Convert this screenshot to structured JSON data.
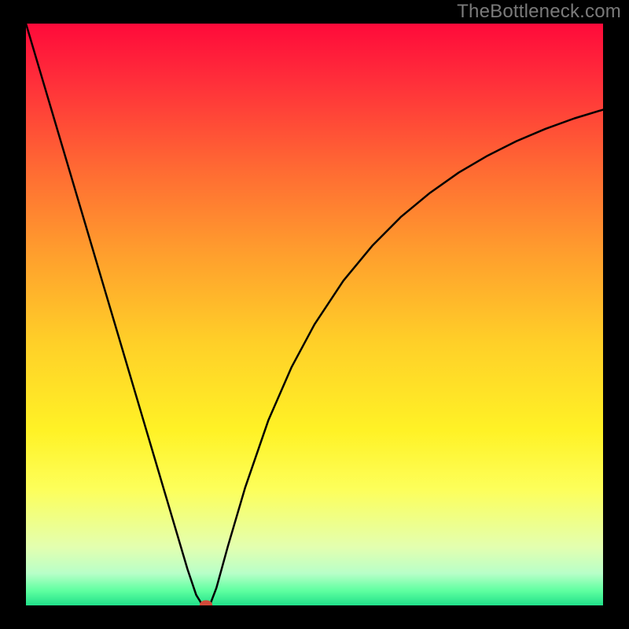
{
  "watermark": "TheBottleneck.com",
  "chart_data": {
    "type": "line",
    "title": "",
    "xlabel": "",
    "ylabel": "",
    "xlim": [
      0,
      100
    ],
    "ylim": [
      0,
      100
    ],
    "background_gradient": {
      "stops": [
        {
          "offset": 0.0,
          "color": "#ff0a3a"
        },
        {
          "offset": 0.1,
          "color": "#ff2f3a"
        },
        {
          "offset": 0.25,
          "color": "#ff6a33"
        },
        {
          "offset": 0.4,
          "color": "#ffa02d"
        },
        {
          "offset": 0.55,
          "color": "#ffd028"
        },
        {
          "offset": 0.7,
          "color": "#fff226"
        },
        {
          "offset": 0.8,
          "color": "#fdff5a"
        },
        {
          "offset": 0.9,
          "color": "#e3ffb0"
        },
        {
          "offset": 0.945,
          "color": "#b8ffc8"
        },
        {
          "offset": 0.975,
          "color": "#5effa0"
        },
        {
          "offset": 1.0,
          "color": "#21e08a"
        }
      ]
    },
    "series": [
      {
        "name": "bottleneck-curve",
        "color": "#000000",
        "stroke_width": 2.5,
        "x": [
          0,
          2,
          4,
          6,
          8,
          10,
          12,
          14,
          16,
          18,
          20,
          22,
          24,
          26,
          28,
          29.5,
          30.5,
          31,
          31.5,
          32,
          33,
          35,
          38,
          42,
          46,
          50,
          55,
          60,
          65,
          70,
          75,
          80,
          85,
          90,
          95,
          100
        ],
        "values": [
          100,
          93.3,
          86.6,
          79.9,
          73.2,
          66.5,
          59.8,
          53.1,
          46.4,
          39.7,
          33.0,
          26.3,
          19.6,
          12.9,
          6.2,
          1.8,
          0.2,
          0.0,
          0.0,
          0.4,
          3.0,
          10.2,
          20.3,
          31.8,
          40.9,
          48.3,
          55.8,
          61.8,
          66.8,
          70.9,
          74.4,
          77.3,
          79.8,
          81.9,
          83.7,
          85.2
        ]
      }
    ],
    "marker": {
      "x": 31.2,
      "y": 0.1,
      "rx": 1.1,
      "ry": 0.8,
      "color": "#d24a3a"
    }
  }
}
